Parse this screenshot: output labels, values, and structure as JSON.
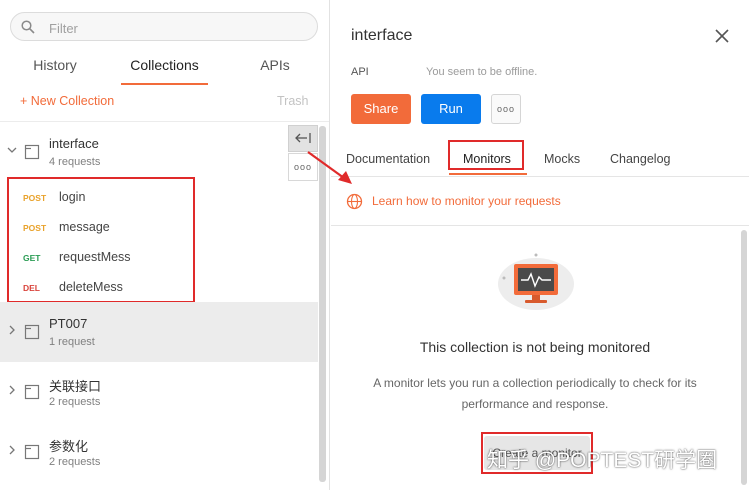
{
  "sidebar": {
    "search_placeholder": "Filter",
    "tabs": {
      "history": "History",
      "collections": "Collections",
      "apis": "APIs"
    },
    "new_collection": "+ New Collection",
    "trash": "Trash",
    "collections": [
      {
        "name": "interface",
        "count": "4 requests"
      },
      {
        "name": "PT007",
        "count": "1 request"
      },
      {
        "name": "关联接口",
        "count": "2 requests"
      },
      {
        "name": "参数化",
        "count": "2 requests"
      }
    ],
    "requests": [
      {
        "method": "POST",
        "name": "login"
      },
      {
        "method": "POST",
        "name": "message"
      },
      {
        "method": "GET",
        "name": "requestMess"
      },
      {
        "method": "DEL",
        "name": "deleteMess"
      }
    ],
    "collapse_icon_glyph": "⟵|",
    "more_glyph": "ooo"
  },
  "panel": {
    "title": "interface",
    "api_label": "API",
    "offline_text": "You seem to be offline.",
    "share": "Share",
    "run": "Run",
    "more_glyph": "ooo",
    "tabs": {
      "documentation": "Documentation",
      "monitors": "Monitors",
      "mocks": "Mocks",
      "changelog": "Changelog"
    },
    "learn_link": "Learn how to monitor your requests",
    "empty_title": "This collection is not being monitored",
    "empty_desc": "A monitor lets you run a collection periodically to check for its performance and response.",
    "create_button": "Create a monitor"
  },
  "watermark": "知乎 @POPTEST研学圈",
  "colors": {
    "accent": "#f26b3a",
    "run_blue": "#097bed",
    "annotation_red": "#e02a2a",
    "post": "#e9a22b",
    "get": "#2a9c54",
    "del": "#d9433b"
  },
  "icons": [
    "search-icon",
    "chevron-down-icon",
    "chevron-right-icon",
    "folder-icon",
    "collapse-sidebar-icon",
    "more-icon",
    "close-icon",
    "globe-icon",
    "monitor-illustration"
  ]
}
